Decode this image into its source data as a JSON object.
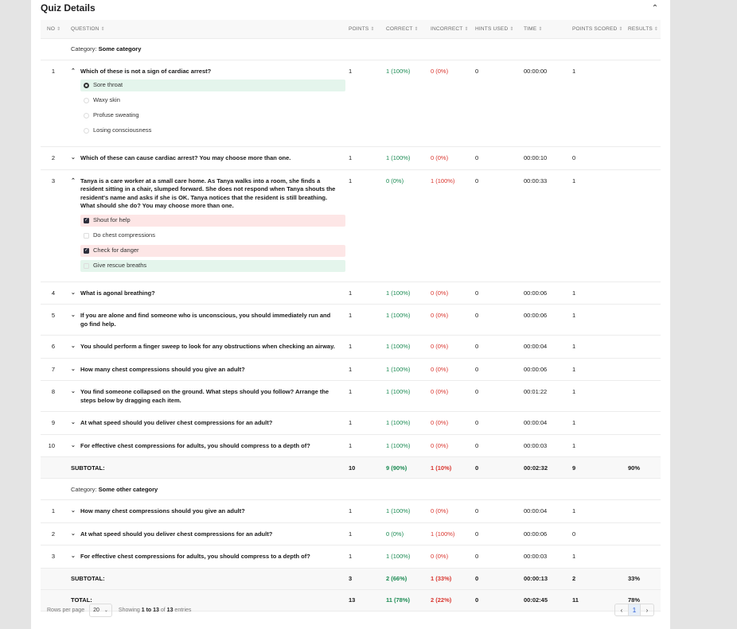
{
  "header": {
    "title": "Quiz Details",
    "collapse_icon": "chevron-up-icon"
  },
  "columns": [
    "NO",
    "QUESTION",
    "POINTS",
    "CORRECT",
    "INCORRECT",
    "HINTS USED",
    "TIME",
    "POINTS SCORED",
    "RESULTS"
  ],
  "category_label": "Category:",
  "colors": {
    "correct": "#1a8a52",
    "incorrect": "#d9362f",
    "answer_correct_bg": "#e4f5ec",
    "answer_incorrect_bg": "#fde6e6"
  },
  "categories": [
    {
      "name": "Some category",
      "questions": [
        {
          "no": "1",
          "text": "Which of these is not a sign of cardiac arrest?",
          "expanded": true,
          "answer_type": "radio",
          "answers": [
            {
              "label": "Sore throat",
              "selected": true,
              "state": "correct"
            },
            {
              "label": "Waxy skin",
              "selected": false,
              "state": ""
            },
            {
              "label": "Profuse sweating",
              "selected": false,
              "state": ""
            },
            {
              "label": "Losing consciousness",
              "selected": false,
              "state": ""
            }
          ],
          "points": "1",
          "correct": "1 (100%)",
          "incorrect": "0 (0%)",
          "hints": "0",
          "time": "00:00:00",
          "scored": "1"
        },
        {
          "no": "2",
          "text": "Which of these can cause cardiac arrest? You may choose more than one.",
          "expanded": false,
          "points": "1",
          "correct": "1 (100%)",
          "incorrect": "0 (0%)",
          "hints": "0",
          "time": "00:00:10",
          "scored": "0"
        },
        {
          "no": "3",
          "text": "Tanya is a care worker at a small care home. As Tanya walks into a room, she finds a resident sitting in a chair, slumped forward. She does not respond when Tanya shouts the resident's name and asks if she is OK. Tanya notices that the resident is still breathing. What should she do? You may choose more than one.",
          "expanded": true,
          "answer_type": "checkbox",
          "answers": [
            {
              "label": "Shout for help",
              "selected": true,
              "state": "incorrect"
            },
            {
              "label": "Do chest compressions",
              "selected": false,
              "state": ""
            },
            {
              "label": "Check for danger",
              "selected": true,
              "state": "incorrect"
            },
            {
              "label": "Give rescue breaths",
              "selected": false,
              "state": "correct"
            }
          ],
          "points": "1",
          "correct": "0 (0%)",
          "incorrect": "1 (100%)",
          "hints": "0",
          "time": "00:00:33",
          "scored": "1"
        },
        {
          "no": "4",
          "text": "What is agonal breathing?",
          "expanded": false,
          "points": "1",
          "correct": "1 (100%)",
          "incorrect": "0 (0%)",
          "hints": "0",
          "time": "00:00:06",
          "scored": "1"
        },
        {
          "no": "5",
          "text": "If you are alone and find someone who is unconscious, you should immediately run and go find help.",
          "expanded": false,
          "points": "1",
          "correct": "1 (100%)",
          "incorrect": "0 (0%)",
          "hints": "0",
          "time": "00:00:06",
          "scored": "1"
        },
        {
          "no": "6",
          "text": "You should perform a finger sweep to look for any obstructions when checking an airway.",
          "expanded": false,
          "points": "1",
          "correct": "1 (100%)",
          "incorrect": "0 (0%)",
          "hints": "0",
          "time": "00:00:04",
          "scored": "1"
        },
        {
          "no": "7",
          "text": "How many chest compressions should you give an adult?",
          "expanded": false,
          "points": "1",
          "correct": "1 (100%)",
          "incorrect": "0 (0%)",
          "hints": "0",
          "time": "00:00:06",
          "scored": "1"
        },
        {
          "no": "8",
          "text": "You find someone collapsed on the ground. What steps should you follow? Arrange the steps below by dragging each item.",
          "expanded": false,
          "points": "1",
          "correct": "1 (100%)",
          "incorrect": "0 (0%)",
          "hints": "0",
          "time": "00:01:22",
          "scored": "1"
        },
        {
          "no": "9",
          "text": "At what speed should you deliver chest compressions for an adult?",
          "expanded": false,
          "points": "1",
          "correct": "1 (100%)",
          "incorrect": "0 (0%)",
          "hints": "0",
          "time": "00:00:04",
          "scored": "1"
        },
        {
          "no": "10",
          "text": "For effective chest compressions for adults, you should compress to a depth of?",
          "expanded": false,
          "points": "1",
          "correct": "1 (100%)",
          "incorrect": "0 (0%)",
          "hints": "0",
          "time": "00:00:03",
          "scored": "1"
        }
      ],
      "subtotal": {
        "label": "SUBTOTAL:",
        "points": "10",
        "correct": "9 (90%)",
        "incorrect": "1 (10%)",
        "hints": "0",
        "time": "00:02:32",
        "scored": "9",
        "result": "90%"
      }
    },
    {
      "name": "Some other category",
      "questions": [
        {
          "no": "1",
          "text": "How many chest compressions should you give an adult?",
          "expanded": false,
          "points": "1",
          "correct": "1 (100%)",
          "incorrect": "0 (0%)",
          "hints": "0",
          "time": "00:00:04",
          "scored": "1"
        },
        {
          "no": "2",
          "text": "At what speed should you deliver chest compressions for an adult?",
          "expanded": false,
          "points": "1",
          "correct": "0 (0%)",
          "incorrect": "1 (100%)",
          "hints": "0",
          "time": "00:00:06",
          "scored": "0"
        },
        {
          "no": "3",
          "text": "For effective chest compressions for adults, you should compress to a depth of?",
          "expanded": false,
          "points": "1",
          "correct": "1 (100%)",
          "incorrect": "0 (0%)",
          "hints": "0",
          "time": "00:00:03",
          "scored": "1"
        }
      ],
      "subtotal": {
        "label": "SUBTOTAL:",
        "points": "3",
        "correct": "2 (66%)",
        "incorrect": "1 (33%)",
        "hints": "0",
        "time": "00:00:13",
        "scored": "2",
        "result": "33%"
      }
    }
  ],
  "total": {
    "label": "TOTAL:",
    "points": "13",
    "correct": "11 (78%)",
    "incorrect": "2 (22%)",
    "hints": "0",
    "time": "00:02:45",
    "scored": "11",
    "result": "78%"
  },
  "footer": {
    "rows_per_page_label": "Rows per page",
    "rows_per_page_value": "20",
    "showing_prefix": "Showing",
    "showing_range": "1 to 13",
    "showing_of": "of",
    "showing_total": "13",
    "showing_suffix": "entries",
    "current_page": "1"
  }
}
